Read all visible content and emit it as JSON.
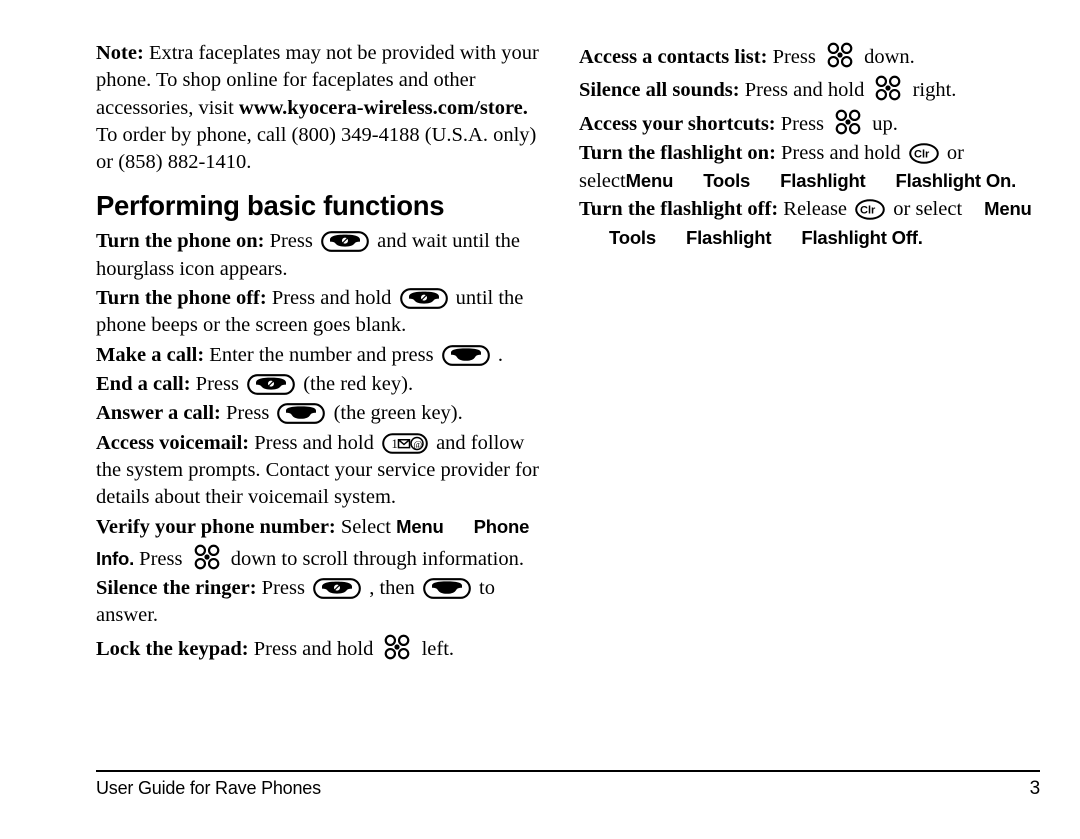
{
  "document": {
    "footer_title": "User Guide for Rave Phones",
    "page_number": "3"
  },
  "left_column": {
    "note": {
      "label": "Note:",
      "text_before_url": " Extra faceplates may not be provided with your phone. To shop online for faceplates and other accessories, visit ",
      "url": "www.kyocera-wireless.com/store.",
      "text_after_url": " To order by phone, call (800) 349-4188 (U.S.A. only) or (858) 882-1410."
    },
    "section_heading": "Performing basic functions",
    "items": [
      {
        "lead": "Turn the phone on:",
        "before": " Press ",
        "icon": "end-call-key-icon",
        "after": " and wait until the hourglass icon appears."
      },
      {
        "lead": "Turn the phone off:",
        "before": " Press and hold ",
        "icon": "end-call-key-icon",
        "after": " until the phone beeps or the screen goes blank."
      },
      {
        "lead": "Make a call:",
        "before": " Enter the number and press ",
        "icon": "send-call-key-icon",
        "after": " ."
      },
      {
        "lead": "End a call:",
        "before": " Press ",
        "icon": "end-call-key-icon",
        "after": " (the red key)."
      },
      {
        "lead": "Answer a call:",
        "before": " Press ",
        "icon": "send-call-key-icon",
        "after": " (the green key)."
      },
      {
        "lead": "Access voicemail:",
        "before": " Press and hold ",
        "icon": "voicemail-key-icon",
        "after": " and follow the system prompts. Contact your service provider for details about their voicemail system."
      }
    ],
    "verify_number": {
      "lead": "Verify your phone number:",
      "before": " Select ",
      "menu_path": [
        "Menu",
        "Phone Info."
      ],
      "middle": " Press ",
      "icon": "navigation-key-icon",
      "after": " down to scroll through information."
    },
    "silence_ringer": {
      "lead": "Silence the ringer:",
      "before": " Press ",
      "icon1": "end-call-key-icon",
      "middle": " , then ",
      "icon2": "send-call-key-icon",
      "after": " to answer."
    },
    "lock_keypad": {
      "lead": "Lock the keypad:",
      "before": " Press and hold ",
      "icon": "navigation-key-icon",
      "after": " left."
    }
  },
  "right_column": {
    "items": [
      {
        "lead": "Access a contacts list:",
        "before": " Press ",
        "icon": "navigation-key-icon",
        "after": " down."
      },
      {
        "lead": "Silence all sounds:",
        "before": " Press and hold ",
        "icon": "navigation-key-icon",
        "after": " right."
      },
      {
        "lead": "Access your shortcuts:",
        "before": " Press ",
        "icon": "navigation-key-icon",
        "after": " up."
      }
    ],
    "flashlight_on": {
      "lead": "Turn the flashlight on:",
      "before": " Press and hold ",
      "icon": "clear-key-icon",
      "after": " or select",
      "menu_path": [
        "Menu",
        "Tools",
        "Flashlight",
        "Flashlight On."
      ]
    },
    "flashlight_off": {
      "lead": "Turn the flashlight off:",
      "before": " Release ",
      "icon": "clear-key-icon",
      "after": " or select",
      "menu_path": [
        "Menu",
        "Tools",
        "Flashlight",
        "Flashlight Off."
      ]
    }
  }
}
